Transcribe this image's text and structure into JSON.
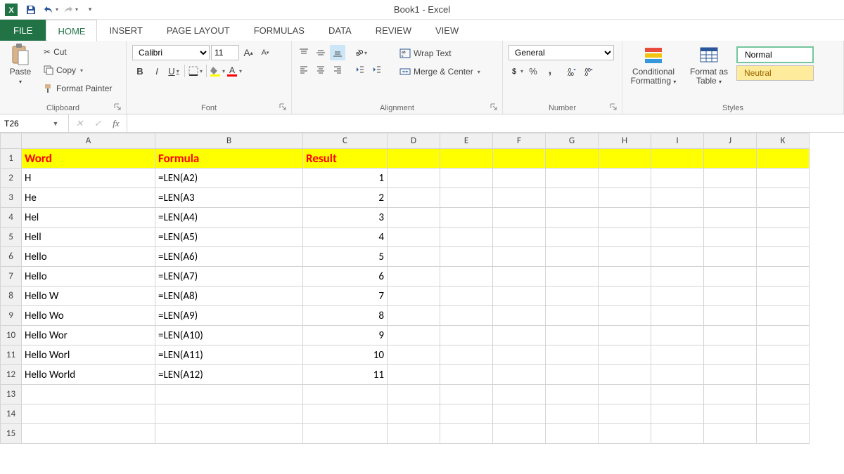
{
  "title": "Book1 - Excel",
  "qat": {
    "save_tip": "Save",
    "undo_tip": "Undo",
    "redo_tip": "Redo"
  },
  "tabs": {
    "file": "FILE",
    "home": "HOME",
    "insert": "INSERT",
    "page_layout": "PAGE LAYOUT",
    "formulas": "FORMULAS",
    "data": "DATA",
    "review": "REVIEW",
    "view": "VIEW"
  },
  "ribbon": {
    "clipboard": {
      "label": "Clipboard",
      "paste": "Paste",
      "cut": "Cut",
      "copy": "Copy",
      "painter": "Format Painter"
    },
    "font": {
      "label": "Font",
      "name": "Calibri",
      "size": "11",
      "bold": "B",
      "italic": "I",
      "underline": "U"
    },
    "alignment": {
      "label": "Alignment",
      "wrap": "Wrap Text",
      "merge": "Merge & Center"
    },
    "number": {
      "label": "Number",
      "format": "General",
      "percent": "%",
      "comma": ","
    },
    "styles": {
      "label": "Styles",
      "conditional": "Conditional Formatting",
      "format_table": "Format as Table",
      "normal": "Normal",
      "neutral": "Neutral"
    }
  },
  "namebox": "T26",
  "formula": "",
  "columns": [
    "A",
    "B",
    "C",
    "D",
    "E",
    "F",
    "G",
    "H",
    "I",
    "J",
    "K"
  ],
  "col_widths": {
    "A": 190,
    "B": 210,
    "C": 120
  },
  "header_row": {
    "A": "Word",
    "B": "Formula",
    "C": "Result"
  },
  "rows": [
    {
      "n": 2,
      "A": "H",
      "B": "=LEN(A2)",
      "C": "1"
    },
    {
      "n": 3,
      "A": "He",
      "B": "=LEN(A3",
      "C": "2"
    },
    {
      "n": 4,
      "A": "Hel",
      "B": "=LEN(A4)",
      "C": "3"
    },
    {
      "n": 5,
      "A": "Hell",
      "B": "=LEN(A5)",
      "C": "4"
    },
    {
      "n": 6,
      "A": "Hello",
      "B": "=LEN(A6)",
      "C": "5"
    },
    {
      "n": 7,
      "A": "Hello ",
      "B": "=LEN(A7)",
      "C": "6"
    },
    {
      "n": 8,
      "A": "Hello W",
      "B": "=LEN(A8)",
      "C": "7"
    },
    {
      "n": 9,
      "A": "Hello Wo",
      "B": "=LEN(A9)",
      "C": "8"
    },
    {
      "n": 10,
      "A": "Hello Wor",
      "B": "=LEN(A10)",
      "C": "9"
    },
    {
      "n": 11,
      "A": "Hello Worl",
      "B": "=LEN(A11)",
      "C": "10"
    },
    {
      "n": 12,
      "A": "Hello World",
      "B": "=LEN(A12)",
      "C": "11"
    }
  ],
  "empty_rows": [
    13,
    14,
    15
  ]
}
